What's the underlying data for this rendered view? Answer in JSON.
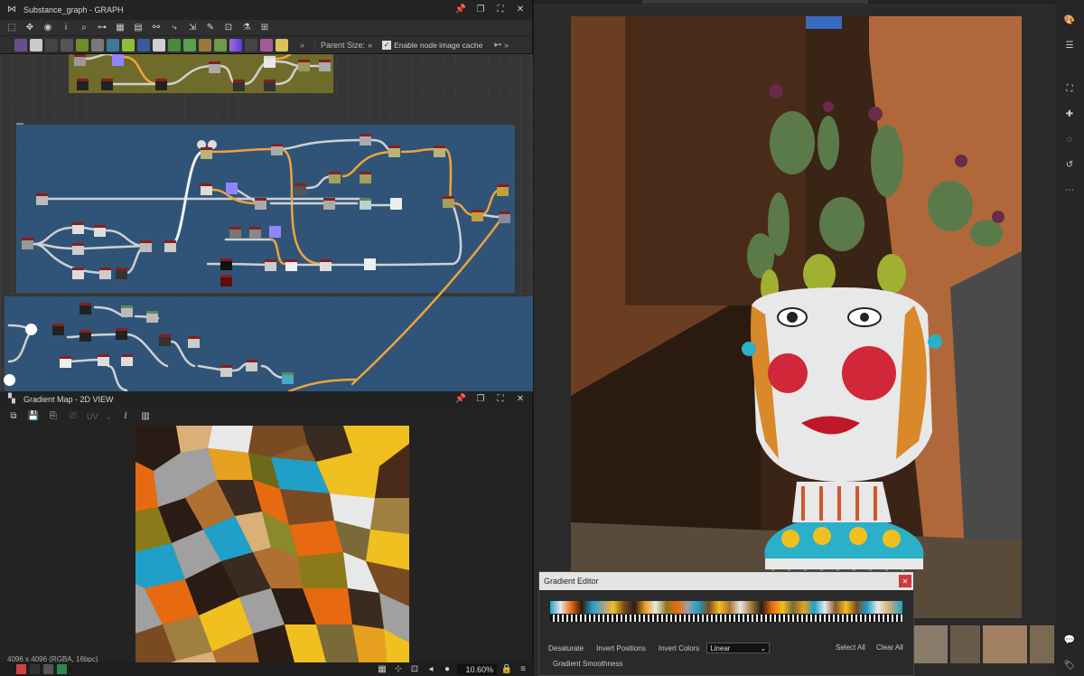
{
  "graph_window": {
    "title": "Substance_graph - GRAPH",
    "parent_size_label": "Parent Size:",
    "parent_size_value": "»",
    "cache_label": "Enable node image cache",
    "cache_checked": true
  },
  "view_window": {
    "title": "Gradient Map - 2D VIEW",
    "uv_label": "UV",
    "info_text": "4096 x 4096 (RGBA, 16bpc)",
    "zoom": "10.60%"
  },
  "gradient_editor": {
    "title": "Gradient Editor",
    "desaturate": "Desaturate",
    "invert_positions": "Invert Positions",
    "invert_colors": "Invert Colors",
    "mode_value": "Linear",
    "select_all": "Select All",
    "clear_all": "Clear All",
    "smoothness": "Gradient Smoothness"
  },
  "colors": {
    "graph_frame_olive": "#6f6b2a",
    "graph_frame_blue": "#2f5478",
    "wire_orange": "#f0a33a",
    "wire_white": "#d0d0d0",
    "accent_red": "#c0392b"
  }
}
